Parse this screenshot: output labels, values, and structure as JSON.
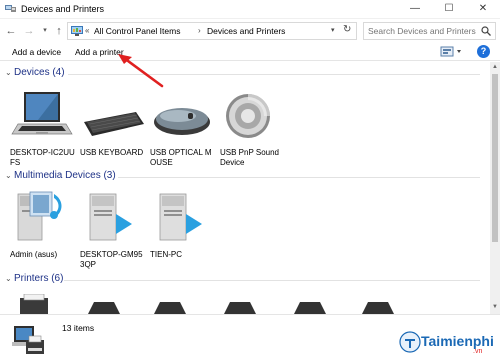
{
  "window": {
    "title": "Devices and Printers",
    "controls": {
      "minimize": "—",
      "maximize": "☐",
      "close": "✕"
    }
  },
  "nav": {
    "breadcrumb": [
      "All Control Panel Items",
      "Devices and Printers"
    ],
    "breadcrumb_prefix": "«",
    "separator": "›",
    "search_placeholder": "Search Devices and Printers"
  },
  "commands": {
    "add_device": "Add a device",
    "add_printer": "Add a printer",
    "help": "?"
  },
  "groups": [
    {
      "title": "Devices (4)",
      "items": [
        {
          "label": "DESKTOP-IC2UUFS",
          "icon": "laptop-icon"
        },
        {
          "label": "USB KEYBOARD",
          "icon": "keyboard-icon"
        },
        {
          "label": "USB OPTICAL MOUSE",
          "icon": "mouse-icon"
        },
        {
          "label": "USB PnP Sound Device",
          "icon": "speaker-icon"
        }
      ]
    },
    {
      "title": "Multimedia Devices (3)",
      "items": [
        {
          "label": "Admin (asus)",
          "icon": "media-server-icon"
        },
        {
          "label": "DESKTOP-GM953QP",
          "icon": "media-server-icon"
        },
        {
          "label": "TIEN-PC",
          "icon": "media-server-icon"
        }
      ]
    },
    {
      "title": "Printers (6)",
      "items": []
    }
  ],
  "status": {
    "item_count": "13 items"
  },
  "watermark": {
    "brand": "Taimienphi",
    "tld": ".vn"
  },
  "colors": {
    "group_title": "#1e3287",
    "annotation_arrow": "#e02020",
    "brand_blue": "#1b69b5"
  }
}
